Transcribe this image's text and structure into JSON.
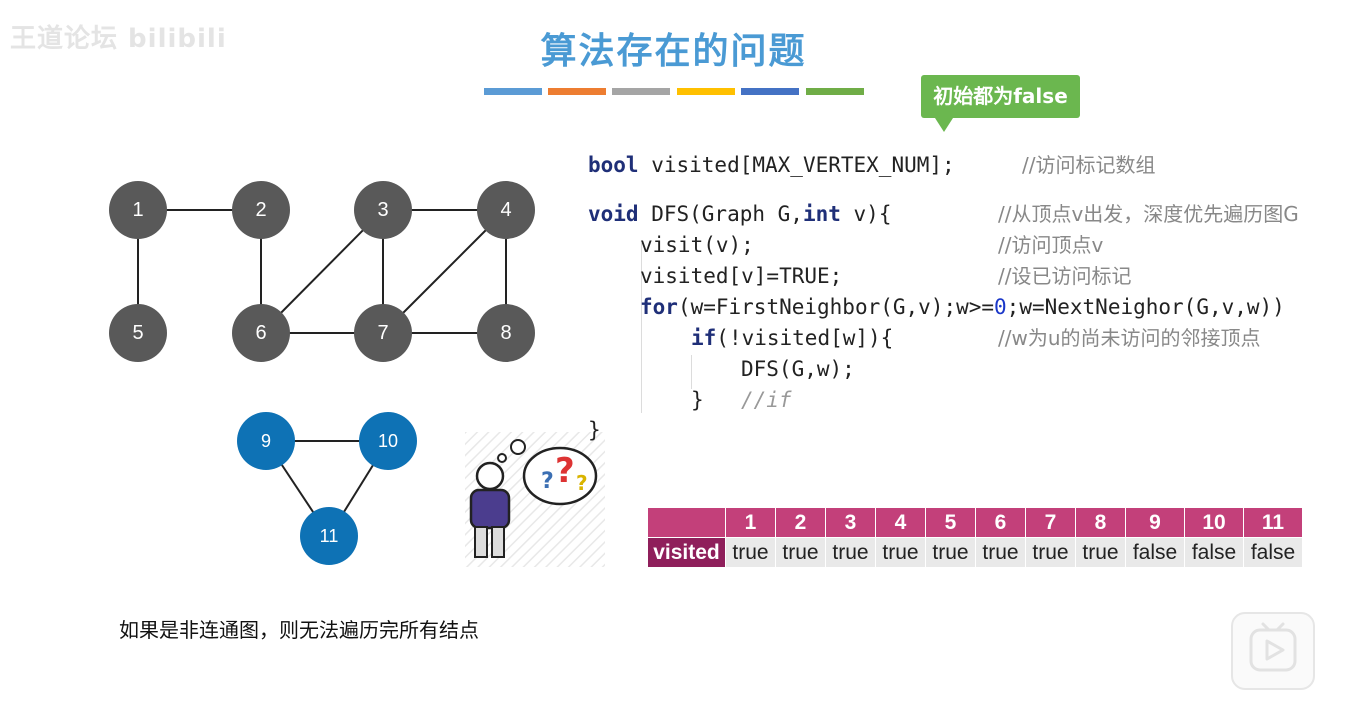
{
  "watermark": "王道论坛 bilibili",
  "title": "算法存在的问题",
  "color_bars": [
    "#5b9bd5",
    "#ed7d31",
    "#a5a5a5",
    "#ffc000",
    "#4472c4",
    "#70ad47"
  ],
  "tooltip": "初始都为false",
  "graph1": {
    "node_color": "#595959",
    "nodes": [
      "1",
      "2",
      "3",
      "4",
      "5",
      "6",
      "7",
      "8"
    ],
    "edges": [
      [
        "1",
        "2"
      ],
      [
        "1",
        "5"
      ],
      [
        "2",
        "6"
      ],
      [
        "3",
        "4"
      ],
      [
        "3",
        "6"
      ],
      [
        "3",
        "7"
      ],
      [
        "4",
        "7"
      ],
      [
        "4",
        "8"
      ],
      [
        "6",
        "7"
      ],
      [
        "7",
        "8"
      ]
    ]
  },
  "graph2": {
    "node_color": "#0e72b5",
    "nodes": [
      "9",
      "10",
      "11"
    ],
    "edges": [
      [
        "9",
        "10"
      ],
      [
        "9",
        "11"
      ],
      [
        "10",
        "11"
      ]
    ]
  },
  "code": {
    "line1": {
      "kw": "bool",
      "rest": " visited[MAX_VERTEX_NUM];",
      "comment": "//访问标记数组"
    },
    "line2": {
      "kw1": "void",
      "mid": " DFS(Graph G,",
      "kw2": "int",
      "rest": " v){",
      "comment": "//从顶点v出发，深度优先遍历图G"
    },
    "line3": {
      "text": "visit(v);",
      "comment": "//访问顶点v"
    },
    "line4": {
      "text": "visited[v]=TRUE;",
      "comment": "//设已访问标记"
    },
    "line5": {
      "kw": "for",
      "a": "(w=FirstNeighbor(G,v);w>=",
      "n1": "0",
      "b": ";w=NextNeighor(G,v,w))"
    },
    "line6": {
      "kw": "if",
      "rest": "(!visited[w]){",
      "comment": "//w为u的尚未访问的邻接顶点"
    },
    "line7": {
      "text": "DFS(G,w);"
    },
    "line8": {
      "text": "}",
      "comment": "//if"
    },
    "line9": {
      "text": "}"
    }
  },
  "table": {
    "row_header": "visited",
    "headers": [
      "1",
      "2",
      "3",
      "4",
      "5",
      "6",
      "7",
      "8",
      "9",
      "10",
      "11"
    ],
    "values": [
      "true",
      "true",
      "true",
      "true",
      "true",
      "true",
      "true",
      "true",
      "false",
      "false",
      "false"
    ]
  },
  "caption": "如果是非连通图，则无法遍历完所有结点"
}
